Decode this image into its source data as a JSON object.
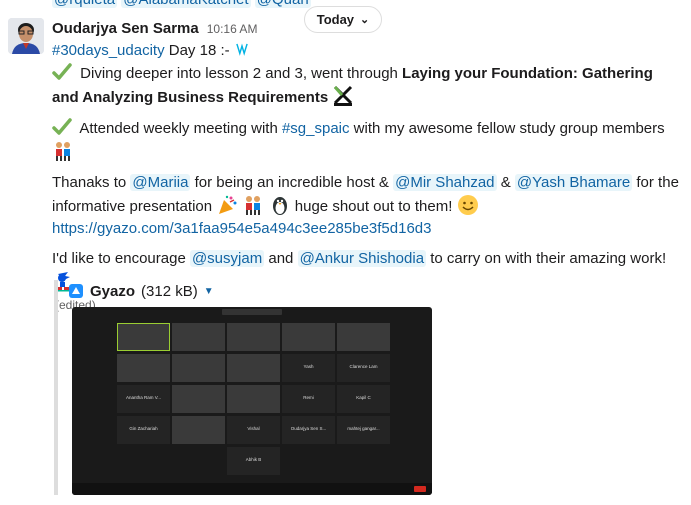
{
  "previous_message_fragment": {
    "mentions": [
      "@rquieta",
      "@AlabamaKatchet",
      "@Quan"
    ]
  },
  "day_divider": {
    "label": "Today"
  },
  "message": {
    "sender": "Oudarjya Sen Sarma",
    "time": "10:16 AM",
    "line1": {
      "hashtag": "#30days_udacity",
      "text": " Day 18 :- "
    },
    "line2": {
      "text": " Diving deeper into lesson 2 and 3, went through ",
      "bold": "Laying your Foundation: Gathering and Analyzing Business Requirements"
    },
    "line3": {
      "text": " Attended weekly meeting with ",
      "hashtag": "#sg_spaic",
      "text2": "  with my awesome fellow study group members"
    },
    "line4": {
      "t1": "Thanaks to ",
      "m1": "@Mariia",
      "t2": " for being an incredible host & ",
      "m2": "@Mir Shahzad",
      "t3": " & ",
      "m3": "@Yash Bhamare",
      "t4": " for the informative presentation ",
      "t5": "  huge shout out to them! "
    },
    "link": "https://gyazo.com/3a1faa954e5a494c3ee285be3f5d16d3",
    "line5": {
      "t1": "I'd like to encourage ",
      "m1": "@susyjam",
      "t2": " and ",
      "m2": "@Ankur Shishodia",
      "t3": " to carry on with their amazing work! "
    },
    "edited": "(edited)"
  },
  "attachment": {
    "name": "Gyazo",
    "size": "(312 kB)",
    "participants": [
      "Yash",
      "Clarence Lam",
      "Anantha Ram V...",
      "Remi",
      "Kapil C",
      "Gin Zachariah",
      "Vishal",
      "Oudarjya Sen S...",
      "mahtej gangar...",
      "Abhik B"
    ]
  },
  "colors": {
    "link": "#1264a3",
    "mention_bg": "#e8f5fa",
    "check": "#77b255"
  }
}
